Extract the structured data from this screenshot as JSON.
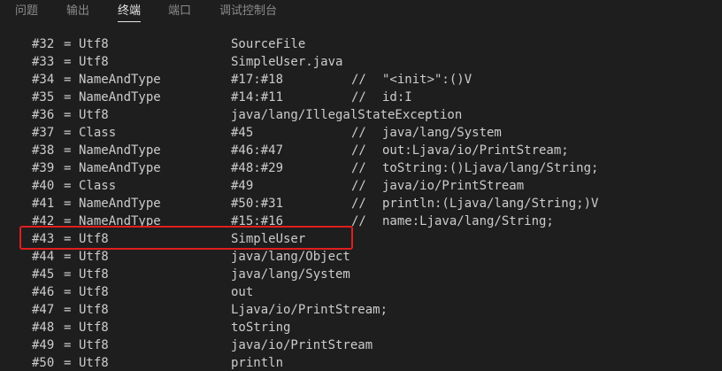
{
  "panel": {
    "tabs": [
      {
        "label": "问题",
        "active": false
      },
      {
        "label": "输出",
        "active": false
      },
      {
        "label": "终端",
        "active": true
      },
      {
        "label": "端口",
        "active": false
      },
      {
        "label": "调试控制台",
        "active": false
      }
    ]
  },
  "terminal": {
    "highlight_color": "#e01e1e",
    "lines": [
      {
        "index": "#32",
        "eq": "=",
        "type": "Utf8",
        "value": "SourceFile",
        "slashes": "",
        "comment": ""
      },
      {
        "index": "#33",
        "eq": "=",
        "type": "Utf8",
        "value": "SimpleUser.java",
        "slashes": "",
        "comment": ""
      },
      {
        "index": "#34",
        "eq": "=",
        "type": "NameAndType",
        "value": "#17:#18",
        "slashes": "//",
        "comment": "\"<init>\":()V"
      },
      {
        "index": "#35",
        "eq": "=",
        "type": "NameAndType",
        "value": "#14:#11",
        "slashes": "//",
        "comment": "id:I"
      },
      {
        "index": "#36",
        "eq": "=",
        "type": "Utf8",
        "value": "java/lang/IllegalStateException",
        "slashes": "",
        "comment": ""
      },
      {
        "index": "#37",
        "eq": "=",
        "type": "Class",
        "value": "#45",
        "slashes": "//",
        "comment": "java/lang/System"
      },
      {
        "index": "#38",
        "eq": "=",
        "type": "NameAndType",
        "value": "#46:#47",
        "slashes": "//",
        "comment": "out:Ljava/io/PrintStream;"
      },
      {
        "index": "#39",
        "eq": "=",
        "type": "NameAndType",
        "value": "#48:#29",
        "slashes": "//",
        "comment": "toString:()Ljava/lang/String;"
      },
      {
        "index": "#40",
        "eq": "=",
        "type": "Class",
        "value": "#49",
        "slashes": "//",
        "comment": "java/io/PrintStream"
      },
      {
        "index": "#41",
        "eq": "=",
        "type": "NameAndType",
        "value": "#50:#31",
        "slashes": "//",
        "comment": "println:(Ljava/lang/String;)V"
      },
      {
        "index": "#42",
        "eq": "=",
        "type": "NameAndType",
        "value": "#15:#16",
        "slashes": "//",
        "comment": "name:Ljava/lang/String;"
      },
      {
        "index": "#43",
        "eq": "=",
        "type": "Utf8",
        "value": "SimpleUser",
        "slashes": "",
        "comment": ""
      },
      {
        "index": "#44",
        "eq": "=",
        "type": "Utf8",
        "value": "java/lang/Object",
        "slashes": "",
        "comment": ""
      },
      {
        "index": "#45",
        "eq": "=",
        "type": "Utf8",
        "value": "java/lang/System",
        "slashes": "",
        "comment": ""
      },
      {
        "index": "#46",
        "eq": "=",
        "type": "Utf8",
        "value": "out",
        "slashes": "",
        "comment": ""
      },
      {
        "index": "#47",
        "eq": "=",
        "type": "Utf8",
        "value": "Ljava/io/PrintStream;",
        "slashes": "",
        "comment": ""
      },
      {
        "index": "#48",
        "eq": "=",
        "type": "Utf8",
        "value": "toString",
        "slashes": "",
        "comment": ""
      },
      {
        "index": "#49",
        "eq": "=",
        "type": "Utf8",
        "value": "java/io/PrintStream",
        "slashes": "",
        "comment": ""
      },
      {
        "index": "#50",
        "eq": "=",
        "type": "Utf8",
        "value": "println",
        "slashes": "",
        "comment": ""
      }
    ]
  }
}
